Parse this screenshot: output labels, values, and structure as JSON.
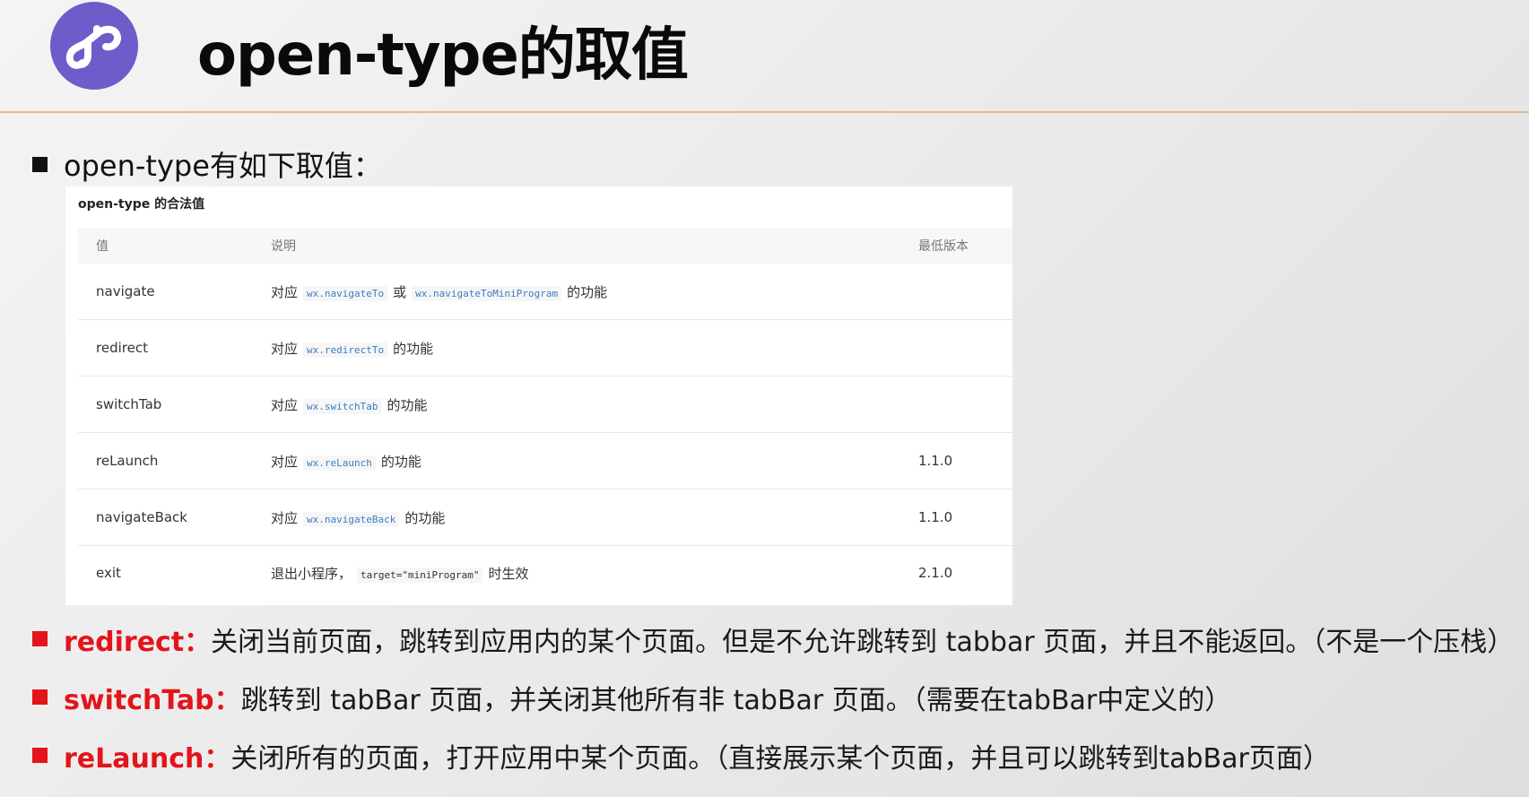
{
  "slide": {
    "title": "open-type的取值",
    "logo_icon": "mini-program-icon",
    "brand_color": "#6f5bc9",
    "accent_color": "#e3141b"
  },
  "intro": {
    "text": "open-type有如下取值："
  },
  "panel": {
    "caption": "open-type 的合法值",
    "headers": [
      "值",
      "说明",
      "最低版本"
    ],
    "rows": [
      {
        "value": "navigate",
        "prefix": "对应",
        "code1": "wx.navigateTo",
        "mid": "或",
        "code2": "wx.navigateToMiniProgram",
        "suffix": "的功能",
        "version": ""
      },
      {
        "value": "redirect",
        "prefix": "对应",
        "code1": "wx.redirectTo",
        "suffix": "的功能",
        "version": ""
      },
      {
        "value": "switchTab",
        "prefix": "对应",
        "code1": "wx.switchTab",
        "suffix": "的功能",
        "version": ""
      },
      {
        "value": "reLaunch",
        "prefix": "对应",
        "code1": "wx.reLaunch",
        "suffix": "的功能",
        "version": "1.1.0"
      },
      {
        "value": "navigateBack",
        "prefix": "对应",
        "code1": "wx.navigateBack",
        "suffix": "的功能",
        "version": "1.1.0"
      },
      {
        "value": "exit",
        "prefix": "退出小程序，",
        "code1": "target=\"miniProgram\"",
        "suffix": "时生效",
        "version": "2.1.0"
      }
    ]
  },
  "items": [
    {
      "key": "redirect：",
      "text": "关闭当前页面，跳转到应用内的某个页面。但是不允许跳转到 tabbar 页面，并且不能返回。（不是一个压栈）"
    },
    {
      "key": "switchTab：",
      "text": "跳转到 tabBar 页面，并关闭其他所有非 tabBar 页面。（需要在tabBar中定义的）"
    },
    {
      "key": "reLaunch：",
      "text": "关闭所有的页面，打开应用中某个页面。（直接展示某个页面，并且可以跳转到tabBar页面）"
    }
  ]
}
